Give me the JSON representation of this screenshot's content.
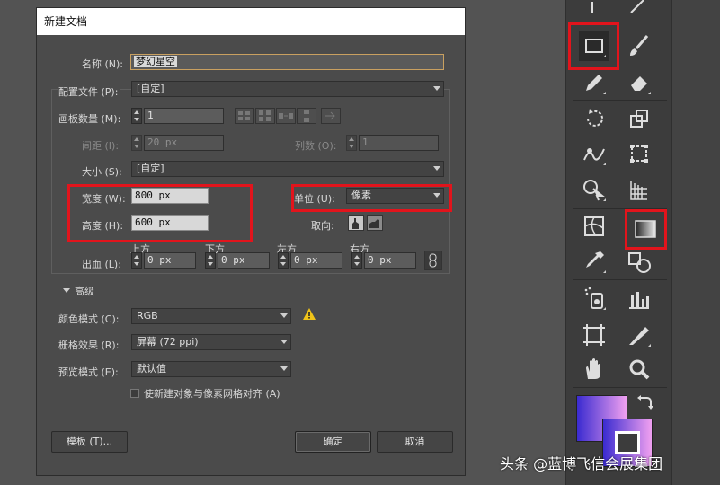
{
  "dialog": {
    "title": "新建文档",
    "name_label": "名称 (N):",
    "name_value": "梦幻星空",
    "profile_label": "配置文件 (P):",
    "profile_value": "[自定]",
    "artboards_label": "画板数量 (M):",
    "artboards_value": "1",
    "spacing_label": "间距 (I):",
    "spacing_value": "20 px",
    "columns_label": "列数 (O):",
    "columns_value": "1",
    "size_label": "大小 (S):",
    "size_value": "[自定]",
    "width_label": "宽度 (W):",
    "width_value": "800 px",
    "height_label": "高度 (H):",
    "height_value": "600 px",
    "units_label": "单位 (U):",
    "units_value": "像素",
    "orientation_label": "取向:",
    "bleed_label": "出血 (L):",
    "bleed_top_label": "上方",
    "bleed_bottom_label": "下方",
    "bleed_left_label": "左方",
    "bleed_right_label": "右方",
    "bleed_top_value": "0 px",
    "bleed_bottom_value": "0 px",
    "bleed_left_value": "0 px",
    "bleed_right_value": "0 px",
    "advanced_label": "高级",
    "color_mode_label": "颜色模式 (C):",
    "color_mode_value": "RGB",
    "raster_label": "栅格效果 (R):",
    "raster_value": "屏幕 (72 ppi)",
    "preview_label": "预览模式 (E):",
    "preview_value": "默认值",
    "align_label": "使新建对象与像素网格对齐 (A)",
    "align_checked": false,
    "template_button": "模板 (T)...",
    "ok_button": "确定",
    "cancel_button": "取消"
  },
  "toolbox": {
    "tools": [
      "selection-tool",
      "line-tool",
      "rectangle-tool",
      "paintbrush-tool",
      "pencil-tool",
      "eraser-tool",
      "rotate-tool",
      "scale-tool",
      "warp-tool",
      "free-transform-tool",
      "shape-builder-tool",
      "perspective-grid-tool",
      "mesh-tool",
      "gradient-tool",
      "eyedropper-tool",
      "blend-tool",
      "symbol-sprayer-tool",
      "column-graph-tool",
      "artboard-tool",
      "slice-tool",
      "hand-tool",
      "zoom-tool",
      "fill-stroke-swatch",
      "swap-fill-stroke"
    ],
    "highlighted": [
      "rectangle-tool",
      "gradient-tool"
    ],
    "fill_gradient": [
      "#3a2bd0",
      "#f0a0f0"
    ]
  },
  "highlight_color": "#e2141c",
  "watermark": "头条 @蓝博飞信会展集团"
}
